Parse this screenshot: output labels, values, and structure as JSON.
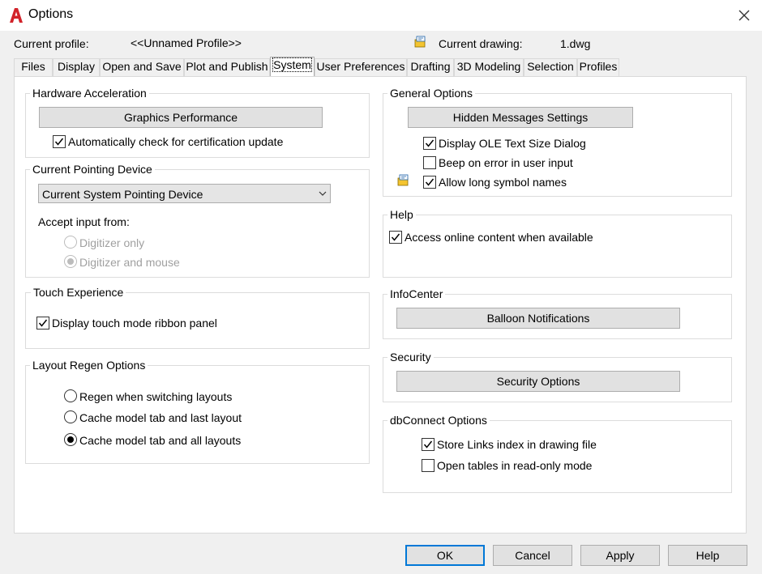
{
  "window": {
    "title": "Options",
    "icon": "autocad-a-icon"
  },
  "header": {
    "current_profile_label": "Current profile:",
    "current_profile_value": "<<Unnamed Profile>>",
    "current_drawing_label": "Current drawing:",
    "current_drawing_value": "1.dwg"
  },
  "tabs": [
    "Files",
    "Display",
    "Open and Save",
    "Plot and Publish",
    "System",
    "User Preferences",
    "Drafting",
    "3D Modeling",
    "Selection",
    "Profiles"
  ],
  "active_tab": "System",
  "hardware": {
    "title": "Hardware Acceleration",
    "graphics_button": "Graphics Performance",
    "auto_check_label": "Automatically check for certification update",
    "auto_check_checked": true
  },
  "pointing": {
    "title": "Current Pointing Device",
    "device_selected": "Current System Pointing Device",
    "accept_label": "Accept input from:",
    "digitizer_only": "Digitizer only",
    "digitizer_and_mouse": "Digitizer and mouse"
  },
  "touch": {
    "title": "Touch Experience",
    "ribbon_label": "Display touch mode ribbon panel",
    "ribbon_checked": true
  },
  "layout_regen": {
    "title": "Layout Regen Options",
    "opt1": "Regen when switching layouts",
    "opt2": "Cache model tab and last layout",
    "opt3": "Cache model tab and all layouts",
    "selected": "Cache model tab and all layouts"
  },
  "general": {
    "title": "General Options",
    "hidden_msgs_button": "Hidden Messages Settings",
    "ole_label": "Display OLE Text Size Dialog",
    "ole_checked": true,
    "beep_label": "Beep on error in user input",
    "beep_checked": false,
    "long_names_label": "Allow long symbol names",
    "long_names_checked": true
  },
  "help": {
    "title": "Help",
    "online_label": "Access online content when available",
    "online_checked": true
  },
  "infocenter": {
    "title": "InfoCenter",
    "balloon_button": "Balloon Notifications"
  },
  "security": {
    "title": "Security",
    "security_button": "Security Options"
  },
  "dbconnect": {
    "title": "dbConnect Options",
    "store_links_label": "Store Links index in drawing file",
    "store_links_checked": true,
    "readonly_label": "Open tables in read-only mode",
    "readonly_checked": false
  },
  "footer": {
    "ok": "OK",
    "cancel": "Cancel",
    "apply": "Apply",
    "help": "Help"
  },
  "colors": {
    "accent": "#0078d7",
    "brand": "#d2232a"
  }
}
